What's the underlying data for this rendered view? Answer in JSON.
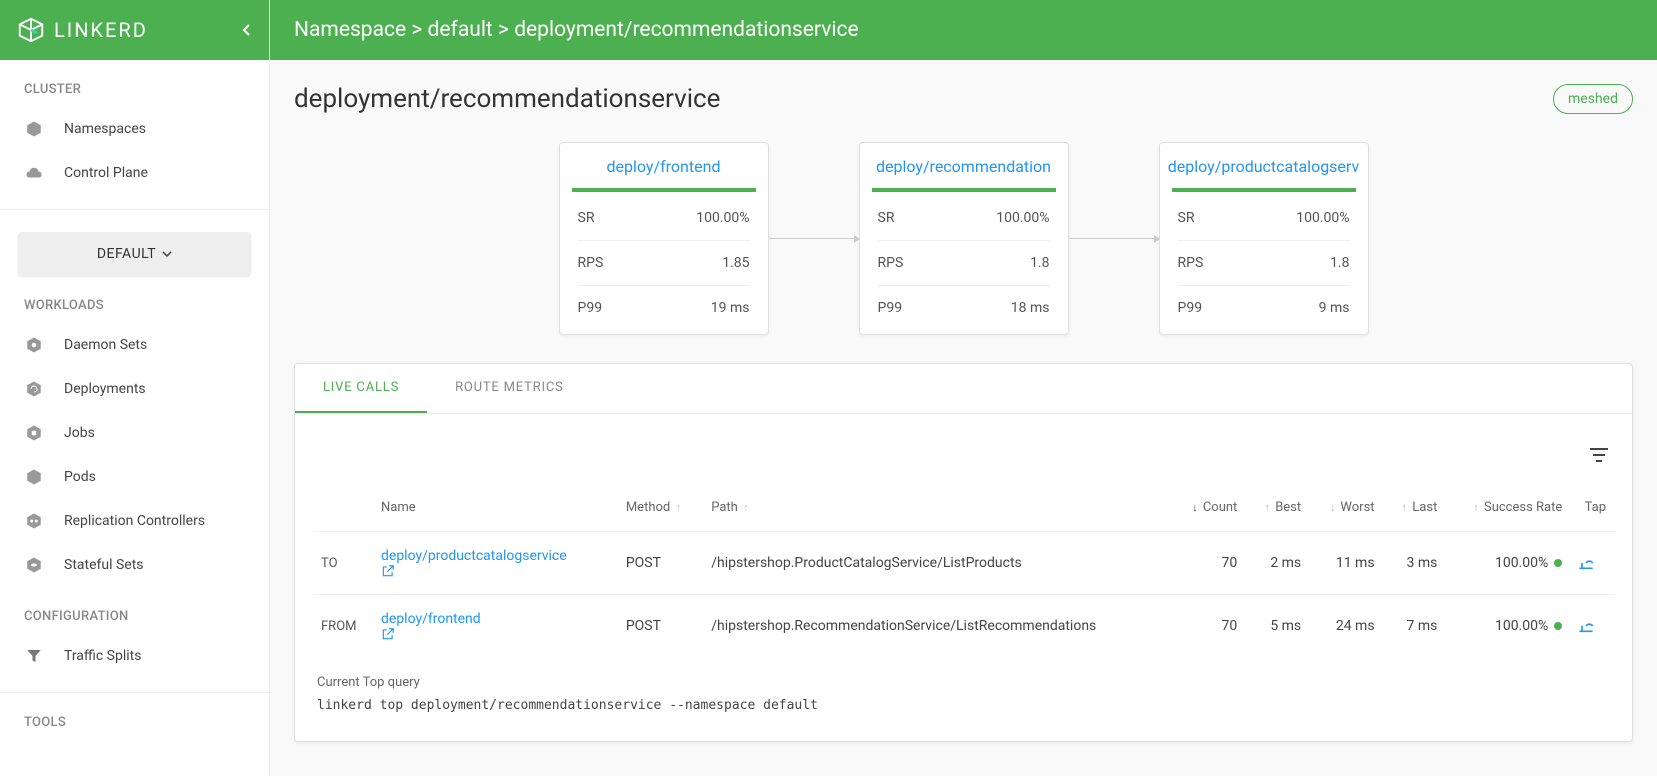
{
  "brand": "LINKERD",
  "sidebar": {
    "cluster_label": "CLUSTER",
    "items_cluster": [
      {
        "label": "Namespaces",
        "icon": "hexagon-icon"
      },
      {
        "label": "Control Plane",
        "icon": "cloud-icon"
      }
    ],
    "namespace_select": "DEFAULT",
    "workloads_label": "WORKLOADS",
    "items_workloads": [
      {
        "label": "Daemon Sets",
        "icon": "daemonset-icon"
      },
      {
        "label": "Deployments",
        "icon": "deployment-icon"
      },
      {
        "label": "Jobs",
        "icon": "job-icon"
      },
      {
        "label": "Pods",
        "icon": "pod-icon"
      },
      {
        "label": "Replication Controllers",
        "icon": "rc-icon"
      },
      {
        "label": "Stateful Sets",
        "icon": "ss-icon"
      }
    ],
    "config_label": "CONFIGURATION",
    "items_config": [
      {
        "label": "Traffic Splits",
        "icon": "funnel-icon"
      }
    ],
    "tools_label": "TOOLS"
  },
  "breadcrumb": "Namespace > default > deployment/recommendationservice",
  "page_title": "deployment/recommendationservice",
  "meshed_label": "meshed",
  "cards": [
    {
      "title": "deploy/frontend",
      "sr": "100.00%",
      "rps": "1.85",
      "p99": "19 ms"
    },
    {
      "title": "deploy/recommendation",
      "sr": "100.00%",
      "rps": "1.8",
      "p99": "18 ms"
    },
    {
      "title": "deploy/productcatalogserv",
      "sr": "100.00%",
      "rps": "1.8",
      "p99": "9 ms"
    }
  ],
  "card_labels": {
    "sr": "SR",
    "rps": "RPS",
    "p99": "P99"
  },
  "tabs": {
    "live": "LIVE CALLS",
    "route": "ROUTE METRICS"
  },
  "table": {
    "headers": {
      "name": "Name",
      "method": "Method",
      "path": "Path",
      "count": "Count",
      "best": "Best",
      "worst": "Worst",
      "last": "Last",
      "success": "Success Rate",
      "tap": "Tap"
    },
    "rows": [
      {
        "dir": "TO",
        "name": "deploy/productcatalogservice",
        "method": "POST",
        "path": "/hipstershop.ProductCatalogService/ListProducts",
        "count": "70",
        "best": "2 ms",
        "worst": "11 ms",
        "last": "3 ms",
        "success": "100.00%"
      },
      {
        "dir": "FROM",
        "name": "deploy/frontend",
        "method": "POST",
        "path": "/hipstershop.RecommendationService/ListRecommendations",
        "count": "70",
        "best": "5 ms",
        "worst": "24 ms",
        "last": "7 ms",
        "success": "100.00%"
      }
    ]
  },
  "query": {
    "label": "Current Top query",
    "code": "linkerd top deployment/recommendationservice --namespace default"
  }
}
